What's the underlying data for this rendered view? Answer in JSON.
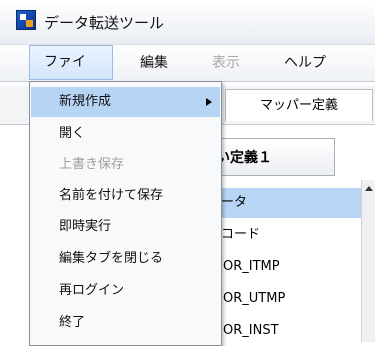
{
  "window": {
    "title": "データ転送ツール"
  },
  "menubar": {
    "items": [
      {
        "label": "ファイル",
        "state": "active"
      },
      {
        "label": "編集",
        "state": "normal"
      },
      {
        "label": "表示",
        "state": "disabled"
      },
      {
        "label": "ヘルプ",
        "state": "normal"
      }
    ]
  },
  "file_menu": {
    "items": [
      {
        "label": "新規作成",
        "has_submenu": true,
        "highlighted": true
      },
      {
        "label": "開く"
      },
      {
        "label": "上書き保存",
        "disabled": true
      },
      {
        "label": "名前を付けて保存"
      },
      {
        "label": "即時実行"
      },
      {
        "label": "編集タブを閉じる"
      },
      {
        "label": "再ログイン"
      },
      {
        "label": "終了"
      }
    ]
  },
  "tabs": {
    "mapper": "マッパー定義"
  },
  "definition_tab": {
    "label": "い定義１"
  },
  "tree": {
    "rows": [
      {
        "label": "ータ",
        "selected": true
      },
      {
        "label": "コード"
      },
      {
        "label": "OR_ITMP",
        "icon": "node-icon"
      },
      {
        "label": "OR_UTMP",
        "icon": "node-icon"
      },
      {
        "label": "OR_INST",
        "icon": "node-icon-pink"
      }
    ]
  },
  "colors": {
    "highlight": "#b8d4f5",
    "menu_active": "#d5e6fb",
    "disabled_text": "#9e9e9e"
  }
}
